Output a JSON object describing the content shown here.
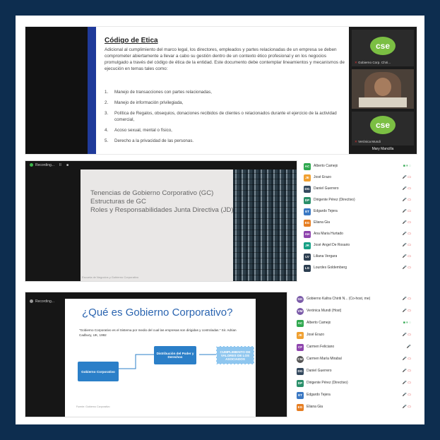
{
  "colors": {
    "background": "#0d2d4f",
    "accent_blue": "#1f3a9a",
    "logo_green": "#7bbf43",
    "diagram_blue": "#2b7fc8",
    "mic_off_red": "#e03131"
  },
  "panel1": {
    "heading": "Código de Ética",
    "paragraph": "Adicional al cumplimiento del marco legal, los directores, empleados y partes relacionadas de un empresa se deben comprometer abiertamente a llevar a cabo su gestión dentro de un contexto ético profesional y en los negocios promulgado a través del código de ética de la entidad. Este documento debe contemplar lineamientos y mecanismos de ejecución en temas tales como:",
    "list": [
      {
        "num": "1.",
        "text": "Manejo de transacciones con partes relacionadas,"
      },
      {
        "num": "2.",
        "text": "Manejo de información privilegiada,"
      },
      {
        "num": "3.",
        "text": "Política de Regalos, obsequios, donaciones recibidos de clientes o relacionados durante el ejercicio de la actividad comercial,"
      },
      {
        "num": "4.",
        "text": "Acoso sexual, mental o físico,"
      },
      {
        "num": "5.",
        "text": "Derecho a la privacidad de las personas."
      }
    ],
    "video_tiles": [
      {
        "logo": "cse",
        "name": "Gobierno Corp. Chiri..."
      },
      {
        "logo": "cse",
        "name": "Verónica Mundi"
      }
    ],
    "speaker_name": "Mary Mancilla"
  },
  "panel2": {
    "toolbar": {
      "recording": "Recording...",
      "pause": "II",
      "stop": "■"
    },
    "slide_title_lines": [
      "Tenencias de Gobierno Corporativo (GC)",
      "Estructuras de GC",
      "Roles y Responsabilidades Junta Directiva (JD)"
    ],
    "slide_footer": "Escuela de Negocios y Gobierno Corporativo",
    "participants": [
      {
        "name": "Alberto Camejo",
        "initials": "AC",
        "color": "#2fa84f",
        "icons": "■ ⏸ ◌"
      },
      {
        "name": "José Erazo",
        "initials": "JE",
        "color": "#f0a030",
        "icons": "🎤 ▭"
      },
      {
        "name": "Daniel Guerrero",
        "initials": "DG",
        "color": "#34495e",
        "icons": "🎤 ▭"
      },
      {
        "name": "Dirigente Pérez (Directivo)",
        "initials": "DP",
        "color": "#2a8f6a",
        "icons": "🎤 ▭"
      },
      {
        "name": "Edgardo Tejera",
        "initials": "ET",
        "color": "#3a78c3",
        "icons": "🎤 ▭"
      },
      {
        "name": "Eliana Gia",
        "initials": "EG",
        "color": "#e67e22",
        "icons": "🎤 ▭"
      },
      {
        "name": "Ana Maria Hurtado",
        "initials": "AH",
        "color": "#8e44ad",
        "icons": "🎤 ▭"
      },
      {
        "name": "José Ángel De Rosario",
        "initials": "JR",
        "color": "#16a085",
        "icons": "🎤 ▭"
      },
      {
        "name": "Liliana Vergara",
        "initials": "LV",
        "color": "#2c3e50",
        "icons": "🎤 ▭"
      },
      {
        "name": "Lourdes Goldemberg",
        "initials": "LG",
        "color": "#2c3e50",
        "icons": "🎤 ▭"
      }
    ]
  },
  "panel3": {
    "toolbar": {
      "recording": "Recording..."
    },
    "title": "¿Qué es Gobierno Corporativo?",
    "quote": "\"Gobierno Corporativo es el Sistema por medio del cual las empresas son dirigidas y controladas.\" Sir. Adrian Cadbury, UK, 1992",
    "boxes": {
      "left": "Gobierno Corporativo",
      "middle": "Distribución del Poder y Derechos",
      "right": "CUMPLIMIENTO DE VALORES DE LOS ASOCIADOS"
    },
    "footer": "Fuente: Gobierno Corporativo",
    "participants": [
      {
        "name": "Gobierno Kaltra Chiriti N... (Co-host, me)",
        "initials": "GK",
        "color": "#7a5aa8",
        "icons": "🎤 ▭"
      },
      {
        "name": "Verónica Mundi (Host)",
        "initials": "VM",
        "color": "#7a5aa8",
        "icons": "🎤 ▭"
      },
      {
        "name": "Alberto Camejo",
        "initials": "AC",
        "color": "#2fa84f",
        "icons": "■ ⏸ ◌"
      },
      {
        "name": "José Erazo",
        "initials": "JE",
        "color": "#f0a030",
        "icons": "🎤 ▭"
      },
      {
        "name": "Carmen Feliciano",
        "initials": "CF",
        "color": "#8e44ad",
        "icons": "🎤"
      },
      {
        "name": "Carmen María Mirabal",
        "initials": "CM",
        "color": "#555",
        "icons": "🎤 ▭"
      },
      {
        "name": "Daniel Guerrero",
        "initials": "DG",
        "color": "#34495e",
        "icons": "🎤 ▭"
      },
      {
        "name": "Dirigente Pérez (Directivo)",
        "initials": "DP",
        "color": "#2a8f6a",
        "icons": "🎤 ▭"
      },
      {
        "name": "Edgardo Tejera",
        "initials": "ET",
        "color": "#3a78c3",
        "icons": "🎤 ▭"
      },
      {
        "name": "Eliana Gia",
        "initials": "EG",
        "color": "#e67e22",
        "icons": "🎤 ▭"
      }
    ]
  }
}
